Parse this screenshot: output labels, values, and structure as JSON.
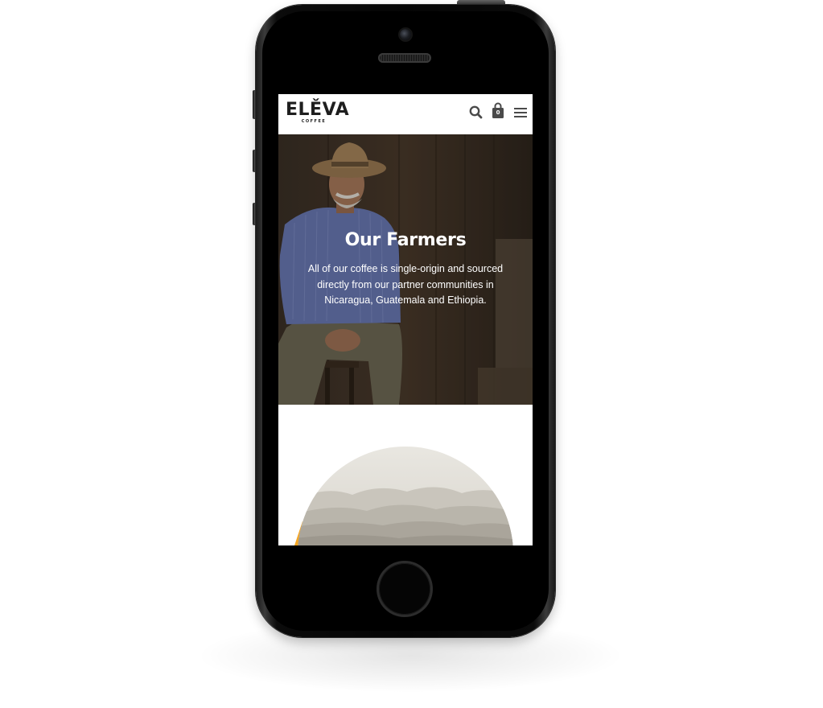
{
  "brand": {
    "name": "ELĚVA",
    "subtitle": "COFFEE"
  },
  "header": {
    "search_icon": "search-icon",
    "cart_icon": "shopping-bag-icon",
    "cart_count": "0",
    "menu_icon": "hamburger-menu-icon"
  },
  "hero": {
    "title": "Our Farmers",
    "description": "All of our coffee is single-origin and sourced directly from our partner communities in Nicaragua, Guatemala and Ethiopia."
  },
  "colors": {
    "accent_orange": "#f5a623",
    "header_icon": "#4a4a4a",
    "hero_overlay": "#3a2e22"
  }
}
